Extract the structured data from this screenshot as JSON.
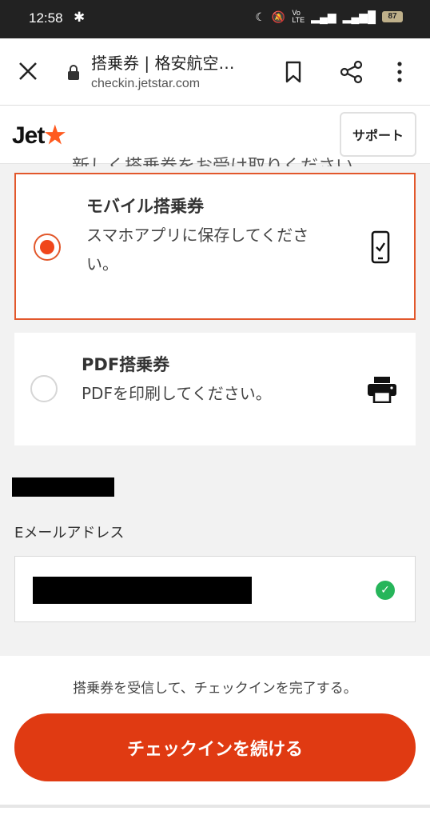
{
  "status_bar": {
    "time": "12:58",
    "battery": "87"
  },
  "browser": {
    "title": "搭乗券 | 格安航空…",
    "url": "checkin.jetstar.com"
  },
  "site": {
    "logo_text": "Jet",
    "support_label": "サポート"
  },
  "clipped_heading": "新しく搭乗券をお受け取りください。",
  "options": [
    {
      "title": "モバイル搭乗券",
      "desc_line1": "スマホアプリに保存してくださ",
      "desc_line2": "い。",
      "selected": true,
      "icon": "mobile-phone-icon"
    },
    {
      "title": "PDF搭乗券",
      "desc_line1": "PDFを印刷してください。",
      "selected": false,
      "icon": "printer-icon"
    }
  ],
  "email": {
    "label": "Eメールアドレス"
  },
  "footer": {
    "note": "搭乗券を受信して、チェックインを完了する。",
    "cta_label": "チェックインを続ける"
  },
  "colors": {
    "accent": "#e03a12",
    "radio_selected": "#f0461b",
    "success": "#26b55a",
    "brand_star": "#ff5a1f"
  }
}
